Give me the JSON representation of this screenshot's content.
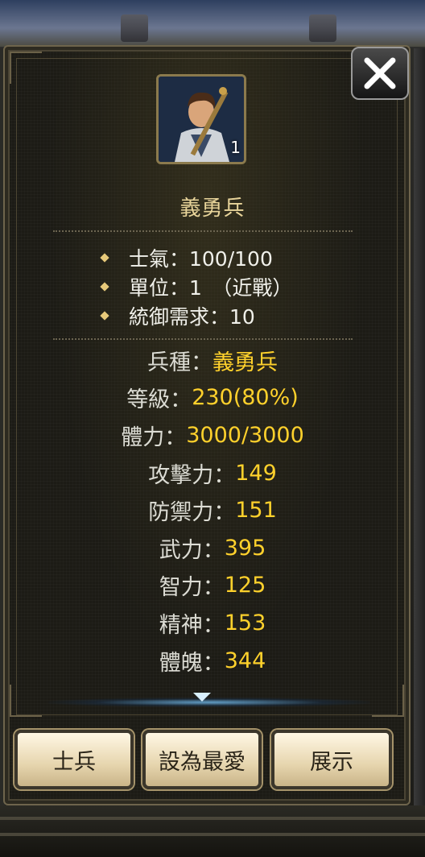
{
  "unit": {
    "name": "義勇兵",
    "portrait_level": "1"
  },
  "info": [
    {
      "label": "士氣：100/100"
    },
    {
      "label": "單位：1　（近戰）"
    },
    {
      "label": "統御需求：10"
    }
  ],
  "stats": [
    {
      "label": "兵種：",
      "value": "義勇兵"
    },
    {
      "label": "等級：",
      "value": "230(80%)"
    },
    {
      "label": "體力：",
      "value": "3000/3000"
    },
    {
      "label": "攻擊力：",
      "value": "149"
    },
    {
      "label": "防禦力：",
      "value": "151"
    },
    {
      "label": "武力：",
      "value": "395"
    },
    {
      "label": "智力：",
      "value": "125"
    },
    {
      "label": "精神：",
      "value": "153"
    },
    {
      "label": "體魄：",
      "value": "344"
    }
  ],
  "buttons": {
    "soldier": "士兵",
    "favorite": "設為最愛",
    "show": "展示"
  },
  "icons": {
    "close": "close-icon",
    "scroll_down": "chevron-down-icon"
  },
  "colors": {
    "stat_value": "#ffd12c",
    "title": "#e8d49a",
    "panel_bg": "#1c1b15"
  }
}
